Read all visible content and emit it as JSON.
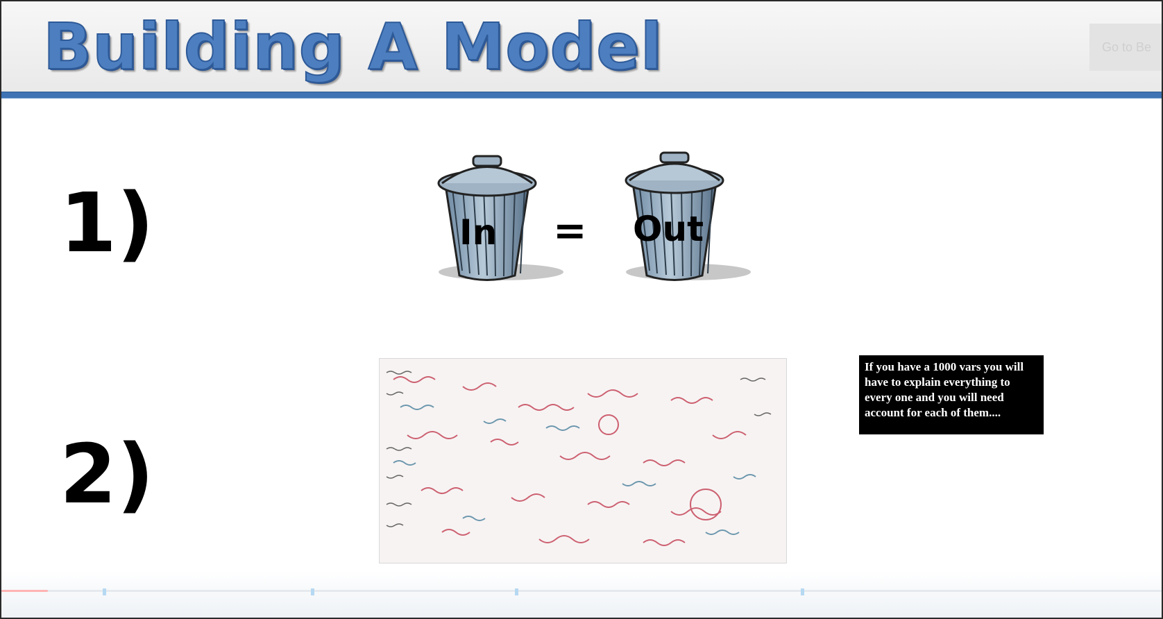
{
  "slide": {
    "title": "Building A Model",
    "header_control_label": "Go to Be",
    "items": [
      {
        "number": "1)",
        "left_word": "In",
        "equals": "=",
        "right_word": "Out"
      },
      {
        "number": "2)",
        "note": "If you have a 1000 vars you will have to explain everything to every one and you will need account for each of them...."
      }
    ]
  },
  "player": {
    "progress_fraction": 0.04
  },
  "colors": {
    "title": "#4d7fc0",
    "rule": "#3f73b3",
    "note_bg": "#000000"
  }
}
